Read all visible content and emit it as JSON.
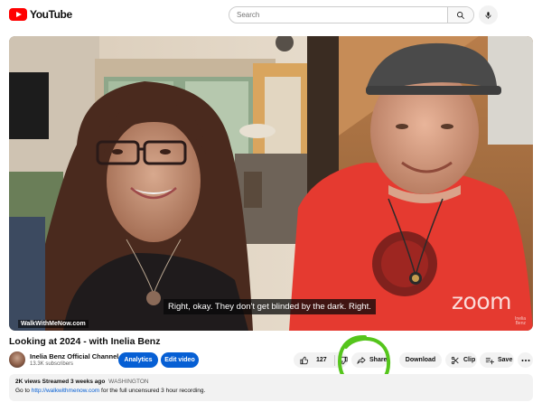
{
  "header": {
    "logo_text": "YouTube",
    "search_placeholder": "Search",
    "brand_color": "#ff0000"
  },
  "video": {
    "caption": "Right, okay. They don't get blinded by the dark. Right.",
    "watermark": "WalkWithMeNow.com",
    "zoom_mark": "zoom",
    "name_tag": "Inelia Benz"
  },
  "meta": {
    "title": "Looking at 2024 - with Inelia Benz",
    "channel_name": "Inelia Benz Official Channel",
    "subscribers": "13.3K subscribers",
    "analytics_label": "Analytics",
    "edit_label": "Edit video",
    "like_count": "127",
    "share_label": "Share",
    "download_label": "Download",
    "clip_label": "Clip",
    "save_label": "Save",
    "accent_color": "#065fd4",
    "highlight_color": "#55c51c"
  },
  "description": {
    "stats": "2K views  Streamed 3 weeks ago",
    "hashtag": "WASHINGTON",
    "line_prefix": "Go to ",
    "link": "http://walkwithmenow.com",
    "line_suffix": " for the full uncensured 3 hour recording."
  }
}
